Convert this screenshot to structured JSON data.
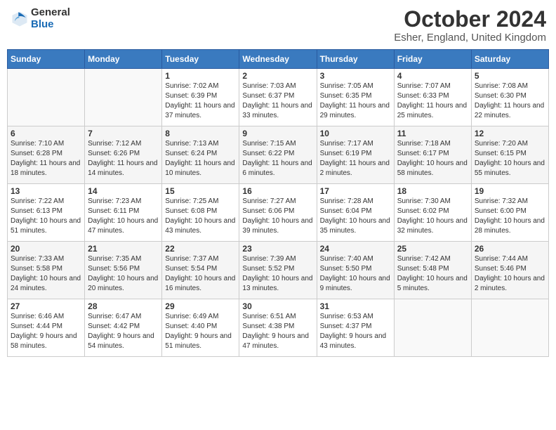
{
  "logo": {
    "general": "General",
    "blue": "Blue"
  },
  "header": {
    "month": "October 2024",
    "location": "Esher, England, United Kingdom"
  },
  "weekdays": [
    "Sunday",
    "Monday",
    "Tuesday",
    "Wednesday",
    "Thursday",
    "Friday",
    "Saturday"
  ],
  "weeks": [
    [
      {
        "day": "",
        "info": ""
      },
      {
        "day": "",
        "info": ""
      },
      {
        "day": "1",
        "info": "Sunrise: 7:02 AM\nSunset: 6:39 PM\nDaylight: 11 hours and 37 minutes."
      },
      {
        "day": "2",
        "info": "Sunrise: 7:03 AM\nSunset: 6:37 PM\nDaylight: 11 hours and 33 minutes."
      },
      {
        "day": "3",
        "info": "Sunrise: 7:05 AM\nSunset: 6:35 PM\nDaylight: 11 hours and 29 minutes."
      },
      {
        "day": "4",
        "info": "Sunrise: 7:07 AM\nSunset: 6:33 PM\nDaylight: 11 hours and 25 minutes."
      },
      {
        "day": "5",
        "info": "Sunrise: 7:08 AM\nSunset: 6:30 PM\nDaylight: 11 hours and 22 minutes."
      }
    ],
    [
      {
        "day": "6",
        "info": "Sunrise: 7:10 AM\nSunset: 6:28 PM\nDaylight: 11 hours and 18 minutes."
      },
      {
        "day": "7",
        "info": "Sunrise: 7:12 AM\nSunset: 6:26 PM\nDaylight: 11 hours and 14 minutes."
      },
      {
        "day": "8",
        "info": "Sunrise: 7:13 AM\nSunset: 6:24 PM\nDaylight: 11 hours and 10 minutes."
      },
      {
        "day": "9",
        "info": "Sunrise: 7:15 AM\nSunset: 6:22 PM\nDaylight: 11 hours and 6 minutes."
      },
      {
        "day": "10",
        "info": "Sunrise: 7:17 AM\nSunset: 6:19 PM\nDaylight: 11 hours and 2 minutes."
      },
      {
        "day": "11",
        "info": "Sunrise: 7:18 AM\nSunset: 6:17 PM\nDaylight: 10 hours and 58 minutes."
      },
      {
        "day": "12",
        "info": "Sunrise: 7:20 AM\nSunset: 6:15 PM\nDaylight: 10 hours and 55 minutes."
      }
    ],
    [
      {
        "day": "13",
        "info": "Sunrise: 7:22 AM\nSunset: 6:13 PM\nDaylight: 10 hours and 51 minutes."
      },
      {
        "day": "14",
        "info": "Sunrise: 7:23 AM\nSunset: 6:11 PM\nDaylight: 10 hours and 47 minutes."
      },
      {
        "day": "15",
        "info": "Sunrise: 7:25 AM\nSunset: 6:08 PM\nDaylight: 10 hours and 43 minutes."
      },
      {
        "day": "16",
        "info": "Sunrise: 7:27 AM\nSunset: 6:06 PM\nDaylight: 10 hours and 39 minutes."
      },
      {
        "day": "17",
        "info": "Sunrise: 7:28 AM\nSunset: 6:04 PM\nDaylight: 10 hours and 35 minutes."
      },
      {
        "day": "18",
        "info": "Sunrise: 7:30 AM\nSunset: 6:02 PM\nDaylight: 10 hours and 32 minutes."
      },
      {
        "day": "19",
        "info": "Sunrise: 7:32 AM\nSunset: 6:00 PM\nDaylight: 10 hours and 28 minutes."
      }
    ],
    [
      {
        "day": "20",
        "info": "Sunrise: 7:33 AM\nSunset: 5:58 PM\nDaylight: 10 hours and 24 minutes."
      },
      {
        "day": "21",
        "info": "Sunrise: 7:35 AM\nSunset: 5:56 PM\nDaylight: 10 hours and 20 minutes."
      },
      {
        "day": "22",
        "info": "Sunrise: 7:37 AM\nSunset: 5:54 PM\nDaylight: 10 hours and 16 minutes."
      },
      {
        "day": "23",
        "info": "Sunrise: 7:39 AM\nSunset: 5:52 PM\nDaylight: 10 hours and 13 minutes."
      },
      {
        "day": "24",
        "info": "Sunrise: 7:40 AM\nSunset: 5:50 PM\nDaylight: 10 hours and 9 minutes."
      },
      {
        "day": "25",
        "info": "Sunrise: 7:42 AM\nSunset: 5:48 PM\nDaylight: 10 hours and 5 minutes."
      },
      {
        "day": "26",
        "info": "Sunrise: 7:44 AM\nSunset: 5:46 PM\nDaylight: 10 hours and 2 minutes."
      }
    ],
    [
      {
        "day": "27",
        "info": "Sunrise: 6:46 AM\nSunset: 4:44 PM\nDaylight: 9 hours and 58 minutes."
      },
      {
        "day": "28",
        "info": "Sunrise: 6:47 AM\nSunset: 4:42 PM\nDaylight: 9 hours and 54 minutes."
      },
      {
        "day": "29",
        "info": "Sunrise: 6:49 AM\nSunset: 4:40 PM\nDaylight: 9 hours and 51 minutes."
      },
      {
        "day": "30",
        "info": "Sunrise: 6:51 AM\nSunset: 4:38 PM\nDaylight: 9 hours and 47 minutes."
      },
      {
        "day": "31",
        "info": "Sunrise: 6:53 AM\nSunset: 4:37 PM\nDaylight: 9 hours and 43 minutes."
      },
      {
        "day": "",
        "info": ""
      },
      {
        "day": "",
        "info": ""
      }
    ]
  ]
}
